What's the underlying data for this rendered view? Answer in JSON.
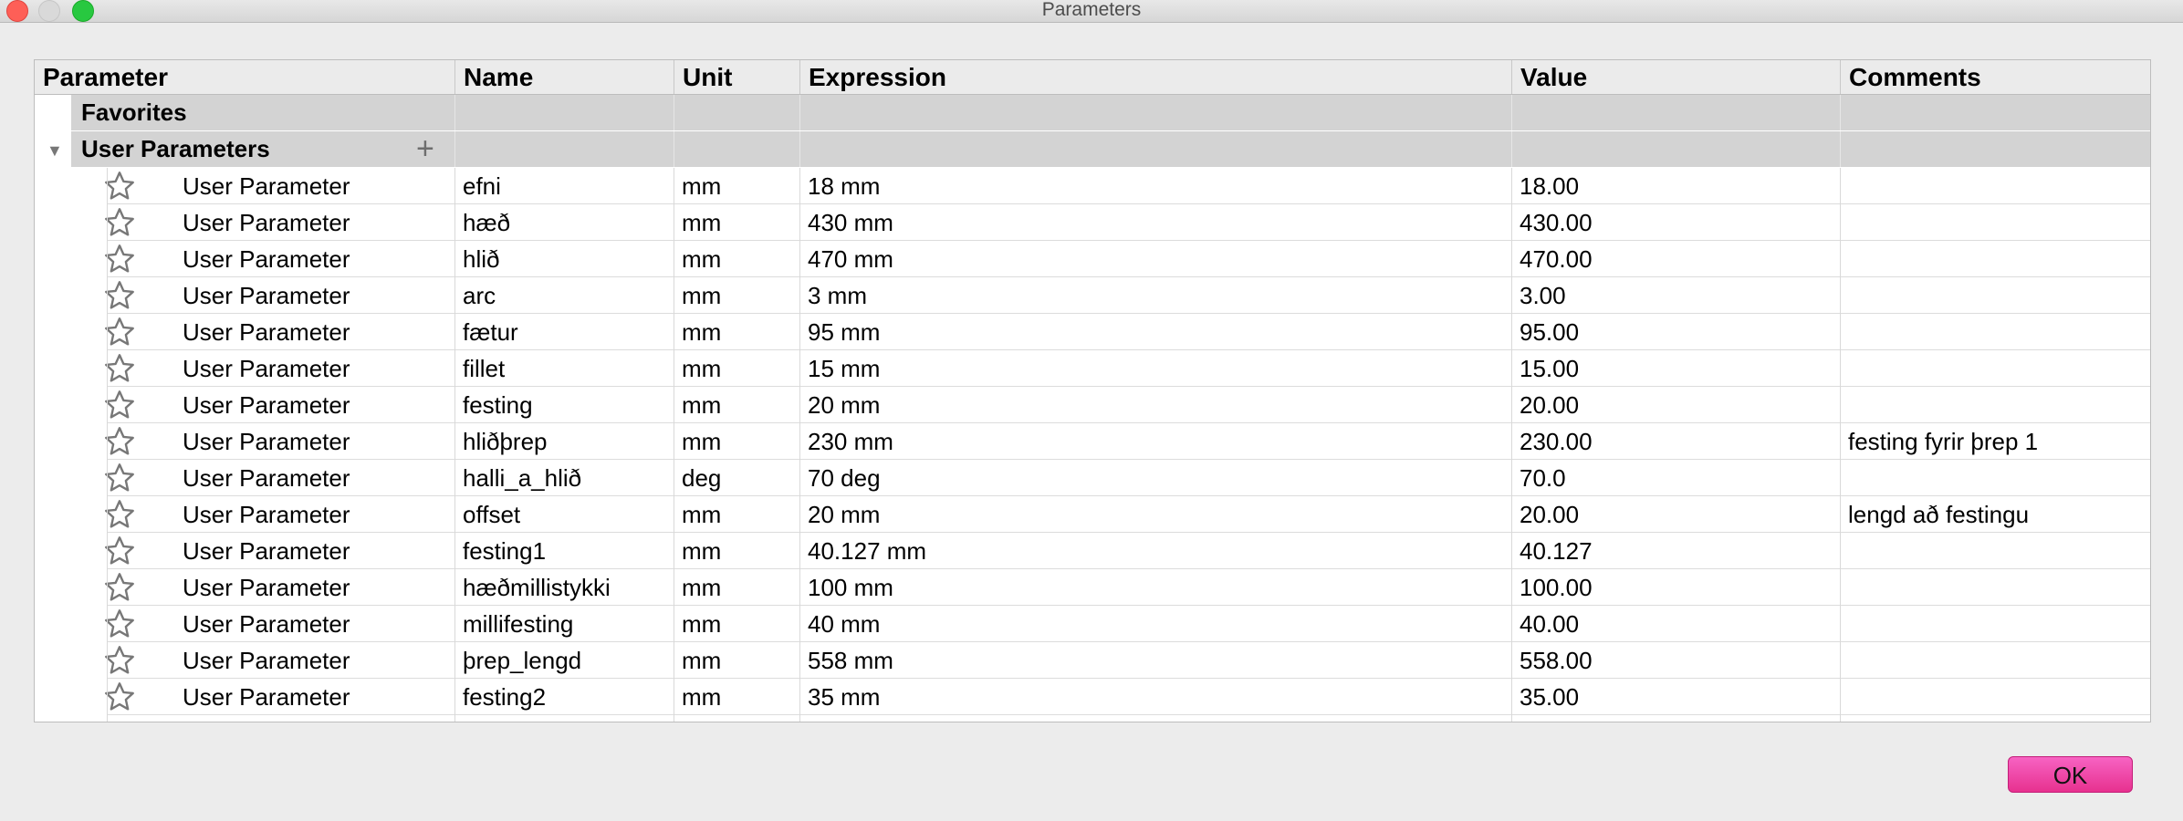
{
  "window": {
    "title": "Parameters"
  },
  "table": {
    "columns": [
      "Parameter",
      "Name",
      "Unit",
      "Expression",
      "Value",
      "Comments"
    ],
    "groups": {
      "favorites": "Favorites",
      "user_parameters": "User Parameters"
    },
    "rows": [
      {
        "parameter": "User Parameter",
        "name": "efni",
        "unit": "mm",
        "expression": "18 mm",
        "value": "18.00",
        "comments": ""
      },
      {
        "parameter": "User Parameter",
        "name": "hæð",
        "unit": "mm",
        "expression": "430 mm",
        "value": "430.00",
        "comments": ""
      },
      {
        "parameter": "User Parameter",
        "name": "hlið",
        "unit": "mm",
        "expression": "470 mm",
        "value": "470.00",
        "comments": ""
      },
      {
        "parameter": "User Parameter",
        "name": "arc",
        "unit": "mm",
        "expression": "3 mm",
        "value": "3.00",
        "comments": ""
      },
      {
        "parameter": "User Parameter",
        "name": "fætur",
        "unit": "mm",
        "expression": "95 mm",
        "value": "95.00",
        "comments": ""
      },
      {
        "parameter": "User Parameter",
        "name": "fillet",
        "unit": "mm",
        "expression": "15 mm",
        "value": "15.00",
        "comments": ""
      },
      {
        "parameter": "User Parameter",
        "name": "festing",
        "unit": "mm",
        "expression": "20 mm",
        "value": "20.00",
        "comments": ""
      },
      {
        "parameter": "User Parameter",
        "name": "hliðþrep",
        "unit": "mm",
        "expression": "230 mm",
        "value": "230.00",
        "comments": "festing fyrir þrep 1"
      },
      {
        "parameter": "User Parameter",
        "name": "halli_a_hlið",
        "unit": "deg",
        "expression": "70 deg",
        "value": "70.0",
        "comments": ""
      },
      {
        "parameter": "User Parameter",
        "name": "offset",
        "unit": "mm",
        "expression": "20 mm",
        "value": "20.00",
        "comments": "lengd að festingu"
      },
      {
        "parameter": "User Parameter",
        "name": "festing1",
        "unit": "mm",
        "expression": "40.127 mm",
        "value": "40.127",
        "comments": ""
      },
      {
        "parameter": "User Parameter",
        "name": "hæðmillistykki",
        "unit": "mm",
        "expression": "100 mm",
        "value": "100.00",
        "comments": ""
      },
      {
        "parameter": "User Parameter",
        "name": "millifesting",
        "unit": "mm",
        "expression": "40 mm",
        "value": "40.00",
        "comments": ""
      },
      {
        "parameter": "User Parameter",
        "name": "þrep_lengd",
        "unit": "mm",
        "expression": "558 mm",
        "value": "558.00",
        "comments": ""
      },
      {
        "parameter": "User Parameter",
        "name": "festing2",
        "unit": "mm",
        "expression": "35 mm",
        "value": "35.00",
        "comments": ""
      }
    ]
  },
  "buttons": {
    "ok": "OK"
  },
  "icons": {
    "row_icon": "star-icon",
    "group_toggle": "triangle-down-icon",
    "add": "plus-icon"
  },
  "colors": {
    "ok_button": "#ee45a8",
    "group_row": "#d3d3d3"
  }
}
